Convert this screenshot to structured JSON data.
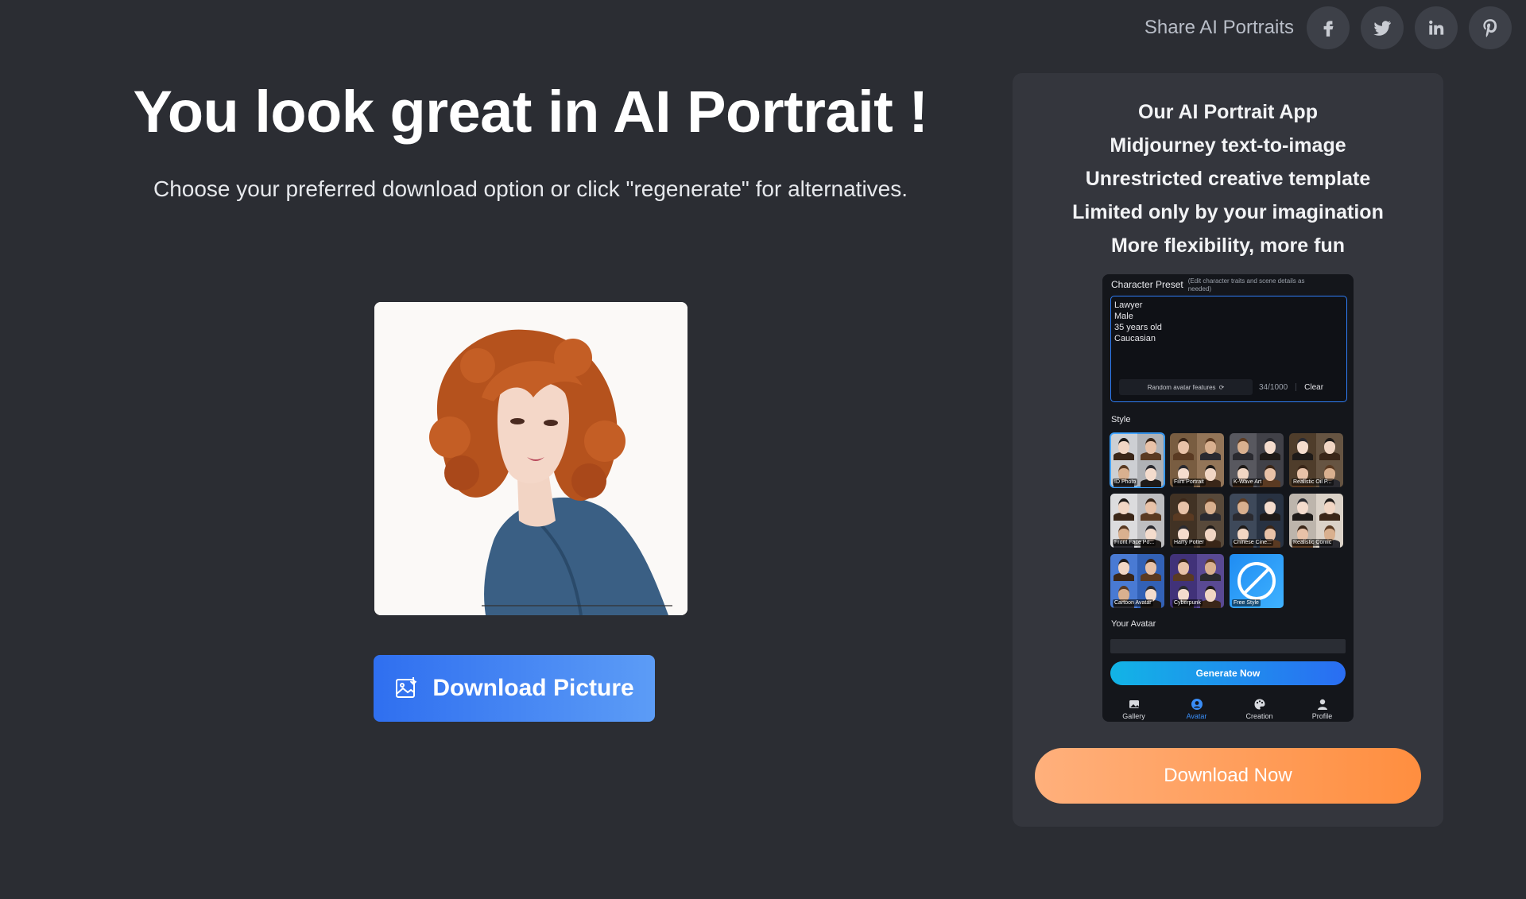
{
  "share": {
    "label": "Share AI Portraits",
    "networks": [
      "facebook-icon",
      "twitter-icon",
      "linkedin-icon",
      "pinterest-icon"
    ]
  },
  "hero": {
    "title": "You look great in AI Portrait !",
    "subtitle": "Choose your preferred download option or click \"regenerate\" for alternatives."
  },
  "download_picture": {
    "label": "Download Picture",
    "icon": "image-download-icon"
  },
  "panel": {
    "features": [
      "Our AI Portrait App",
      "Midjourney text-to-image",
      "Unrestricted creative template",
      "Limited only by your imagination",
      "More flexibility, more fun"
    ],
    "download_now": "Download Now"
  },
  "app": {
    "preset_title": "Character Preset",
    "preset_hint": "(Edit character traits and scene details as needed)",
    "preset_lines": [
      "Lawyer",
      "Male",
      "35 years old",
      "Caucasian"
    ],
    "random_label": "Random avatar features",
    "count": "34/1000",
    "clear": "Clear",
    "style_label": "Style",
    "styles": [
      {
        "name": "ID Photo",
        "selected": true,
        "tone": "#c9cbd0"
      },
      {
        "name": "Film Portrait",
        "selected": false,
        "tone": "#8a6a4a"
      },
      {
        "name": "K-Wave Art",
        "selected": false,
        "tone": "#4a4a52"
      },
      {
        "name": "Realistic Oil P...",
        "selected": false,
        "tone": "#5a4632"
      },
      {
        "name": "Front Face Po...",
        "selected": false,
        "tone": "#d9d9dc"
      },
      {
        "name": "Harry Potter",
        "selected": false,
        "tone": "#4a3a2a"
      },
      {
        "name": "Chinese Cine...",
        "selected": false,
        "tone": "#2e3a4c"
      },
      {
        "name": "Realistic Comic",
        "selected": false,
        "tone": "#d8cfc4"
      },
      {
        "name": "Cartoon Avatar",
        "selected": false,
        "tone": "#3a6fd0"
      },
      {
        "name": "Cyberpunk",
        "selected": false,
        "tone": "#4b3a8a"
      },
      {
        "name": "Free Style",
        "selected": false,
        "tone": "#1f8cf2"
      }
    ],
    "avatar_label": "Your Avatar",
    "generate": "Generate Now",
    "nav": [
      {
        "label": "Gallery",
        "icon": "gallery-icon",
        "active": false
      },
      {
        "label": "Avatar",
        "icon": "avatar-icon",
        "active": true
      },
      {
        "label": "Creation",
        "icon": "palette-icon",
        "active": false
      },
      {
        "label": "Profile",
        "icon": "profile-icon",
        "active": false
      }
    ]
  },
  "colors": {
    "background": "#2b2d33",
    "panel": "#34363d",
    "primary_blue": "#2f6ff0",
    "accent_orange": "#ff8e3f"
  }
}
